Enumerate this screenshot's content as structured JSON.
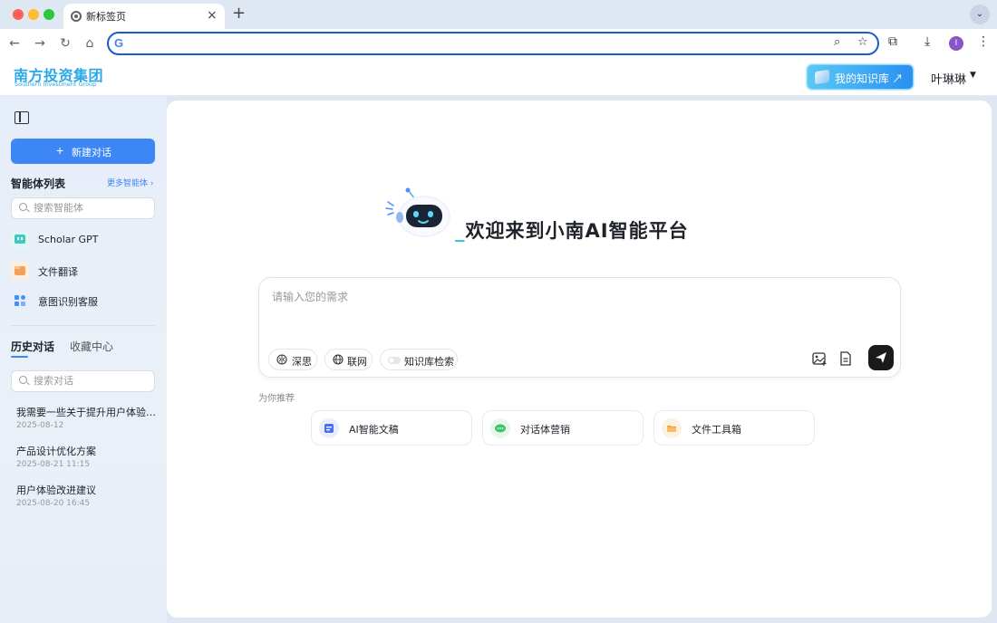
{
  "browser": {
    "tab_title": "新标签页",
    "tab_close": "×",
    "new_tab": "+",
    "google_letter": "G",
    "profile_initial": "I",
    "address_value": ""
  },
  "header": {
    "logo_cn": "南方投资集团",
    "logo_en": "Southern Investment Group",
    "knowledge_button": "我的知识库 ↗",
    "user_name": "叶琳琳"
  },
  "sidebar": {
    "new_chat": "新建对话",
    "agents_title": "智能体列表",
    "more_agents": "更多智能体 ›",
    "agent_search_placeholder": "搜索智能体",
    "agents": [
      {
        "label": "Scholar GPT",
        "icon": "chat-icon",
        "color": "#3ec9c1"
      },
      {
        "label": "文件翻译",
        "icon": "folder-icon",
        "color": "#f5a05a"
      },
      {
        "label": "意图识别客服",
        "icon": "grid-icon",
        "color": "#4a8ff7"
      }
    ],
    "tabs": {
      "history": "历史对话",
      "favorites": "收藏中心"
    },
    "history_search_placeholder": "搜索对话",
    "history": [
      {
        "title": "我需要一些关于提升用户体验的建议",
        "date": "2025-08-12"
      },
      {
        "title": "产品设计优化方案",
        "date": "2025-08-21 11:15"
      },
      {
        "title": "用户体验改进建议",
        "date": "2025-08-20 16:45"
      }
    ]
  },
  "main": {
    "welcome": "欢迎来到小南AI智能平台",
    "welcome_prefix": "_",
    "input_placeholder": "请输入您的需求",
    "chips": {
      "deep_think": "深思",
      "web": "联网",
      "kb_search": "知识库检索"
    },
    "recommend_label": "为你推荐",
    "recommendations": [
      {
        "label": "AI智能文稿",
        "icon": "document-icon",
        "color": "#e8eefc"
      },
      {
        "label": "对话体营销",
        "icon": "message-icon",
        "color": "#e6f7e9"
      },
      {
        "label": "文件工具箱",
        "icon": "folder-icon",
        "color": "#fdf1e2"
      }
    ]
  },
  "colors": {
    "accent": "#3d87f5",
    "brand": "#2aa8e8",
    "send": "#1a1a1a"
  }
}
